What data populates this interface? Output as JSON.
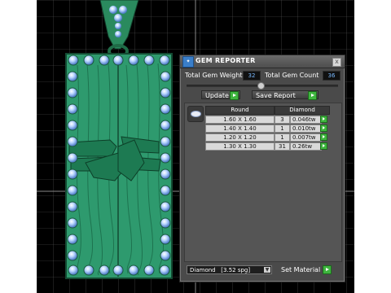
{
  "panel": {
    "title": "GEM REPORTER",
    "icon": "gem-reporter-icon",
    "close_glyph": "x",
    "total_weight_label": "Total Gem Weight",
    "total_weight_value": "32",
    "total_count_label": "Total Gem Count",
    "total_count_value": "36",
    "update_label": "Update",
    "save_label": "Save Report",
    "table": {
      "headers": [
        "Round",
        "Diamond"
      ],
      "rows": [
        {
          "size": "1.60 X 1.60",
          "count": "3",
          "weight": "0.046tw"
        },
        {
          "size": "1.40 X 1.40",
          "count": "1",
          "weight": "0.010tw"
        },
        {
          "size": "1.20 X 1.20",
          "count": "1",
          "weight": "0.007tw"
        },
        {
          "size": "1.30 X 1.30",
          "count": "31",
          "weight": "0.26tw"
        }
      ]
    },
    "material_select": "Diamond   [3.52 spg]",
    "set_material_label": "Set Material"
  },
  "colors": {
    "panel_bg": "#4a4a4a",
    "value_text": "#79b9ff",
    "go_button": "#3eb53e",
    "pendant_green": "#2e9a6e",
    "gem_blue": "#9cc6ff"
  }
}
